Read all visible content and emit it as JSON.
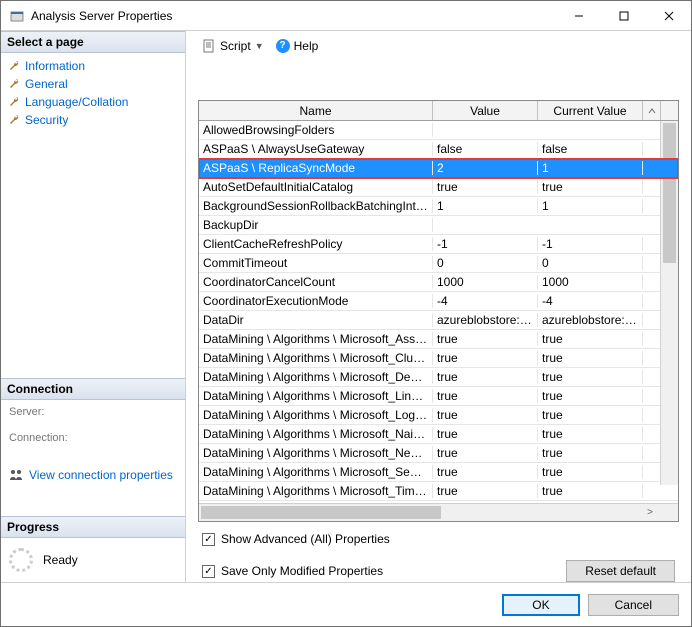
{
  "window": {
    "title": "Analysis Server Properties"
  },
  "sidebar": {
    "select_header": "Select a page",
    "pages": [
      {
        "label": "Information"
      },
      {
        "label": "General"
      },
      {
        "label": "Language/Collation"
      },
      {
        "label": "Security"
      }
    ],
    "connection_header": "Connection",
    "server_label": "Server:",
    "connection_label": "Connection:",
    "view_conn_props": "View connection properties",
    "progress_header": "Progress",
    "progress_status": "Ready"
  },
  "toolbar": {
    "script": "Script",
    "help": "Help"
  },
  "grid": {
    "headers": {
      "name": "Name",
      "value": "Value",
      "current": "Current Value"
    },
    "rows": [
      {
        "name": "AllowedBrowsingFolders",
        "value": "",
        "current": ""
      },
      {
        "name": "ASPaaS \\ AlwaysUseGateway",
        "value": "false",
        "current": "false"
      },
      {
        "name": "ASPaaS \\ ReplicaSyncMode",
        "value": "2",
        "current": "1",
        "highlight": true,
        "selected": true
      },
      {
        "name": "AutoSetDefaultInitialCatalog",
        "value": "true",
        "current": "true"
      },
      {
        "name": "BackgroundSessionRollbackBatchingInterval",
        "value": "1",
        "current": "1"
      },
      {
        "name": "BackupDir",
        "value": "",
        "current": ""
      },
      {
        "name": "ClientCacheRefreshPolicy",
        "value": "-1",
        "current": "-1"
      },
      {
        "name": "CommitTimeout",
        "value": "0",
        "current": "0"
      },
      {
        "name": "CoordinatorCancelCount",
        "value": "1000",
        "current": "1000"
      },
      {
        "name": "CoordinatorExecutionMode",
        "value": "-4",
        "current": "-4"
      },
      {
        "name": "DataDir",
        "value": "azureblobstore:/...",
        "current": "azureblobstore:/..."
      },
      {
        "name": "DataMining \\ Algorithms \\ Microsoft_Associati...",
        "value": "true",
        "current": "true"
      },
      {
        "name": "DataMining \\ Algorithms \\ Microsoft_Clusterin...",
        "value": "true",
        "current": "true"
      },
      {
        "name": "DataMining \\ Algorithms \\ Microsoft_Decision...",
        "value": "true",
        "current": "true"
      },
      {
        "name": "DataMining \\ Algorithms \\ Microsoft_Linear_R...",
        "value": "true",
        "current": "true"
      },
      {
        "name": "DataMining \\ Algorithms \\ Microsoft_Logistic_...",
        "value": "true",
        "current": "true"
      },
      {
        "name": "DataMining \\ Algorithms \\ Microsoft_Naive_B...",
        "value": "true",
        "current": "true"
      },
      {
        "name": "DataMining \\ Algorithms \\ Microsoft_Neural_...",
        "value": "true",
        "current": "true"
      },
      {
        "name": "DataMining \\ Algorithms \\ Microsoft_Sequenc...",
        "value": "true",
        "current": "true"
      },
      {
        "name": "DataMining \\ Algorithms \\ Microsoft_Time_Se...",
        "value": "true",
        "current": "true"
      }
    ]
  },
  "checks": {
    "show_advanced": "Show Advanced (All) Properties",
    "save_modified": "Save Only Modified Properties",
    "reset": "Reset default"
  },
  "footer": {
    "ok": "OK",
    "cancel": "Cancel"
  }
}
